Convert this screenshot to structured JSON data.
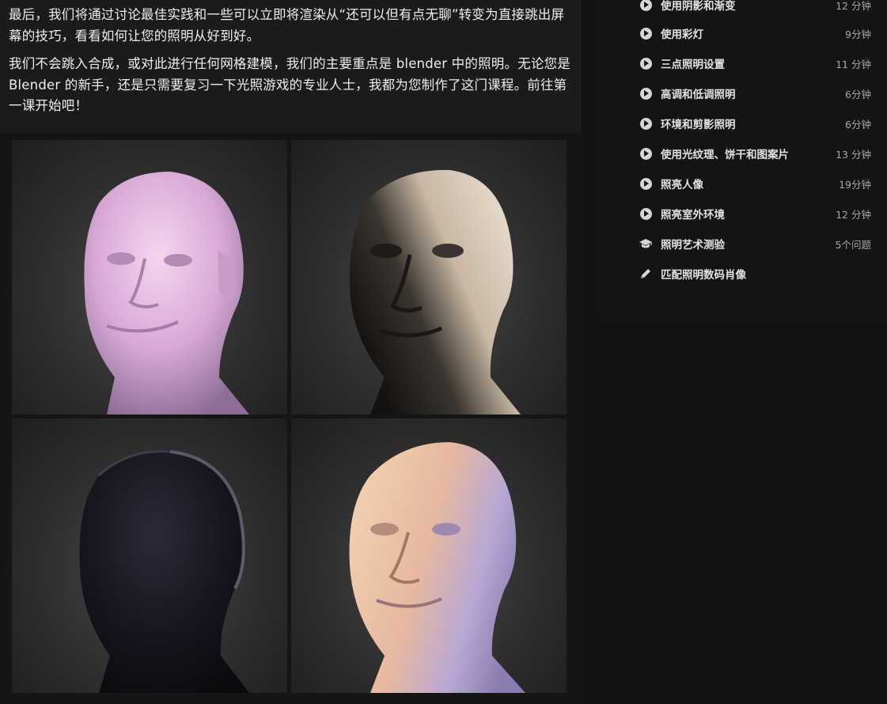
{
  "description": {
    "paragraph1": "最后，我们将通过讨论最佳实践和一些可以立即将渲染从“还可以但有点无聊”转变为直接跳出屏幕的技巧，看看如何让您的照明从好到好。",
    "paragraph2": "我们不会跳入合成，或对此进行任何网格建模，我们的主要重点是 blender 中的照明。无论您是 Blender 的新手，还是只需要复习一下光照游戏的专业人士，我都为您制作了这门课程。前往第一课开始吧！"
  },
  "gallery": {
    "images": [
      {
        "icon": "pink-lit-head-render"
      },
      {
        "icon": "side-lit-head-render"
      },
      {
        "icon": "dark-rim-lit-head-render"
      },
      {
        "icon": "warm-cool-lit-head-render"
      }
    ]
  },
  "lessons": [
    {
      "title": "使用阴影和渐变",
      "duration": "12 分钟",
      "icon": "play-icon"
    },
    {
      "title": "使用彩灯",
      "duration": "9分钟",
      "icon": "play-icon"
    },
    {
      "title": "三点照明设置",
      "duration": "11 分钟",
      "icon": "play-icon"
    },
    {
      "title": "高调和低调照明",
      "duration": "6分钟",
      "icon": "play-icon"
    },
    {
      "title": "环境和剪影照明",
      "duration": "6分钟",
      "icon": "play-icon"
    },
    {
      "title": "使用光纹理、饼干和图案片",
      "duration": "13 分钟",
      "icon": "play-icon"
    },
    {
      "title": "照亮人像",
      "duration": "19分钟",
      "icon": "play-icon"
    },
    {
      "title": "照亮室外环境",
      "duration": "12 分钟",
      "icon": "play-icon"
    },
    {
      "title": "照明艺术测验",
      "duration": "5个问题",
      "icon": "graduation-cap-icon"
    },
    {
      "title": "匹配照明数码肖像",
      "duration": "",
      "icon": "pencil-icon"
    }
  ],
  "colors": {
    "background": "#121212",
    "description_bg": "#1b1b1b",
    "text": "#eeeeee",
    "duration_text": "#a8a8a8"
  }
}
